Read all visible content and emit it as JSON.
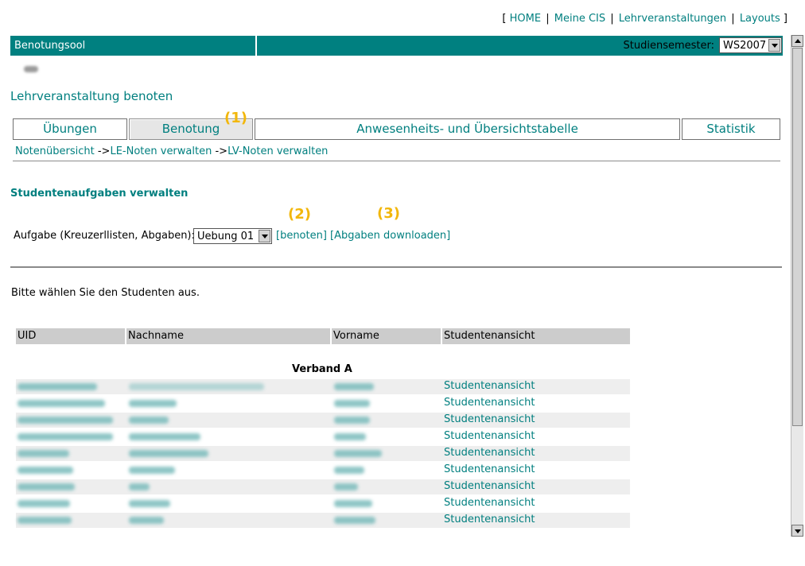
{
  "topnav": {
    "bracket_open": "[",
    "bracket_close": "]",
    "separator": "|",
    "items": [
      "HOME",
      "Meine CIS",
      "Lehrveranstaltungen",
      "Layouts"
    ]
  },
  "header": {
    "app_title": "Benotungsool",
    "semester_label": "Studiensemester:",
    "semester_value": "WS2007"
  },
  "page_title": "Lehrveranstaltung benoten",
  "tabs": [
    {
      "label": "Übungen",
      "active": false
    },
    {
      "label": "Benotung",
      "active": true
    },
    {
      "label": "Anwesenheits- und Übersichtstabelle",
      "active": false
    },
    {
      "label": "Statistik",
      "active": false
    }
  ],
  "callouts": [
    "(1)",
    "(2)",
    "(3)"
  ],
  "breadcrumb": {
    "items": [
      "Notenübersicht",
      "LE-Noten verwalten",
      "LV-Noten verwalten"
    ],
    "arrow": "->"
  },
  "section_title": "Studentenaufgaben verwalten",
  "task": {
    "label": "Aufgabe (Kreuzerllisten, Abgaben):",
    "selected": "Uebung 01",
    "link_grade": "[benoten]",
    "link_download": "[Abgaben downloaden]"
  },
  "instruction": "Bitte wählen Sie den Studenten aus.",
  "table": {
    "headers": [
      "UID",
      "Nachname",
      "Vorname",
      "Studentenansicht"
    ],
    "group": "Verband A",
    "rows_link_text": "Studentenansicht",
    "row_count_visible": 9
  },
  "colors": {
    "teal": "#008080",
    "link": "#007f7f",
    "callout": "#f2b70c",
    "header_gray": "#cccccc"
  }
}
